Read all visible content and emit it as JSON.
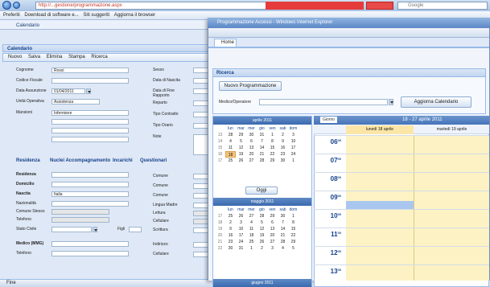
{
  "browser": {
    "address_text": "http://...gestione/programmazione.aspx",
    "search_placeholder": "Google",
    "favorites_label": "Preferiti",
    "fav_links": [
      "Download di software e...",
      "Siti suggeriti",
      "Aggiorna il browser"
    ],
    "tab_label": "Calendario"
  },
  "left_window": {
    "title": "Calendario",
    "toolbar": [
      "Nuovo",
      "Salva",
      "Elimina",
      "Stampa",
      "Ricerca"
    ],
    "labels": {
      "cognome": "Cognome",
      "codice_fiscale": "Codice Fiscale",
      "data_assunzione": "Data Assunzione",
      "unita_operativa": "Unità Operativa",
      "mansioni": "Mansioni",
      "sesso": "Sesso",
      "data_nascita": "Data di Nascita",
      "data_fine": "Data di Fine Rapporto",
      "reparto": "Reparto",
      "tipo_contratto": "Tipo Contratto",
      "tipo_orario": "Tipo Orario",
      "note": "Note",
      "residenza": "Residenza",
      "domicilio": "Domicilio",
      "nascita": "Nascita",
      "nazionalita": "Nazionalità",
      "comune_stesso": "Comune Stesso",
      "telefono": "Telefono",
      "stato_civile": "Stato Civile",
      "figli": "Figli",
      "comune": "Comune",
      "lingua_madre": "Lingua Madre",
      "lettura": "Lettura",
      "cellulare": "Cellulare",
      "scrittura": "Scrittura",
      "medico": "Medico (MMG)",
      "indirizzo": "Indirizzo",
      "telefono2": "Telefono"
    },
    "values": {
      "cognome": "Rossi",
      "data_assunzione": "01/04/2011",
      "unita_operativa": "Assistenza",
      "mansioni": "Infermiere",
      "nascita": "Italia"
    },
    "section_tabs": [
      "Residenza",
      "Nuclei Accompagnamento",
      "Incarichi",
      "Questionari"
    ],
    "status": "Fine"
  },
  "right_window": {
    "title": "Programmazione Accessi - Windows Internet Explorer",
    "tab_label": "Home",
    "panel_title": "Ricerca",
    "new_button": "Nuovo Programmazione",
    "operator_label": "Medico/Operatore",
    "refresh_button": "Aggiorna Calendario",
    "calendar_april": {
      "header": "aprile 2011",
      "weekdays": [
        "lun",
        "mar",
        "mer",
        "gio",
        "ven",
        "sab",
        "dom"
      ],
      "weeks": [
        [
          "13",
          "28",
          "29",
          "30",
          "31",
          "1",
          "2",
          "3"
        ],
        [
          "14",
          "4",
          "5",
          "6",
          "7",
          "8",
          "9",
          "10"
        ],
        [
          "15",
          "11",
          "12",
          "13",
          "14",
          "15",
          "16",
          "17"
        ],
        [
          "16",
          "18",
          "19",
          "20",
          "21",
          "22",
          "23",
          "24"
        ],
        [
          "17",
          "25",
          "26",
          "27",
          "28",
          "29",
          "30",
          "1"
        ]
      ],
      "today": "18"
    },
    "today_button": "Oggi",
    "calendar_may": {
      "header": "maggio 2011",
      "weeks": [
        [
          "17",
          "25",
          "26",
          "27",
          "28",
          "29",
          "30",
          "1"
        ],
        [
          "18",
          "2",
          "3",
          "4",
          "5",
          "6",
          "7",
          "8"
        ],
        [
          "19",
          "9",
          "10",
          "11",
          "12",
          "13",
          "14",
          "15"
        ],
        [
          "20",
          "16",
          "17",
          "18",
          "19",
          "20",
          "21",
          "22"
        ],
        [
          "21",
          "23",
          "24",
          "25",
          "26",
          "27",
          "28",
          "29"
        ],
        [
          "22",
          "30",
          "31",
          "1",
          "2",
          "3",
          "4",
          "5"
        ]
      ]
    },
    "calendar_june_header": "giugno 2011",
    "scheduler": {
      "view_label": "Giorno",
      "range": "18 - 27 aprile 2011",
      "days": [
        "lunedì 18 aprile",
        "martedì 19 aprile"
      ],
      "hours": [
        "06",
        "07",
        "08",
        "09",
        "10",
        "11",
        "12",
        "13"
      ],
      "minutes": "00"
    }
  },
  "colors": {
    "accent": "#3b6aaf",
    "today": "#f4c37d",
    "workhours": "#fdf2c4",
    "selected_slot": "#a9c6ee"
  }
}
